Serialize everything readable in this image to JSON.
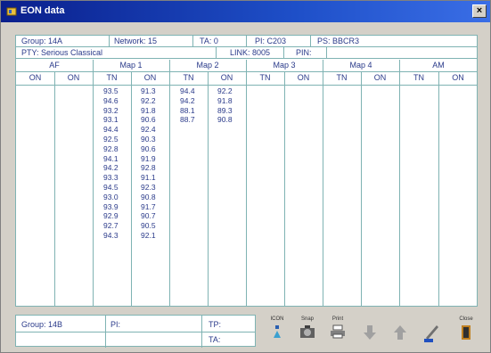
{
  "window": {
    "title": "EON data",
    "close_label": "×"
  },
  "info": {
    "group": "Group:  14A",
    "network": "Network:  15",
    "ta": "TA: 0",
    "pi": "PI: C203",
    "ps": "PS:  BBCR3",
    "pty": "PTY:  Serious Classical",
    "link": "LINK:  8005",
    "pin": "PIN:"
  },
  "table": {
    "groups": [
      {
        "label": "AF",
        "sub": [
          "ON",
          "ON"
        ]
      },
      {
        "label": "Map 1",
        "sub": [
          "TN",
          "ON"
        ]
      },
      {
        "label": "Map 2",
        "sub": [
          "TN",
          "ON"
        ]
      },
      {
        "label": "Map 3",
        "sub": [
          "TN",
          "ON"
        ]
      },
      {
        "label": "Map 4",
        "sub": [
          "TN",
          "ON"
        ]
      },
      {
        "label": "AM",
        "sub": [
          "TN",
          "ON"
        ]
      }
    ],
    "map1_tn": "93.5\n94.6\n93.2\n93.1\n94.4\n92.5\n92.8\n94.1\n94.2\n93.3\n94.5\n93.0\n93.9\n92.9\n92.7\n94.3",
    "map1_on": "91.3\n92.2\n91.8\n90.6\n92.4\n90.3\n90.6\n91.9\n92.8\n91.1\n92.3\n90.8\n91.7\n90.7\n90.5\n92.1",
    "map2_tn": "94.4\n94.2\n88.1\n88.7",
    "map2_on": "92.2\n91.8\n89.3\n90.8"
  },
  "bottom": {
    "group": "Group:  14B",
    "pi": "PI:",
    "tp": "TP:",
    "ta": "TA:"
  },
  "toolbar": {
    "icon_label": "ICON",
    "snap_label": "Snap",
    "print_label": "Print",
    "close_label": "Close"
  }
}
